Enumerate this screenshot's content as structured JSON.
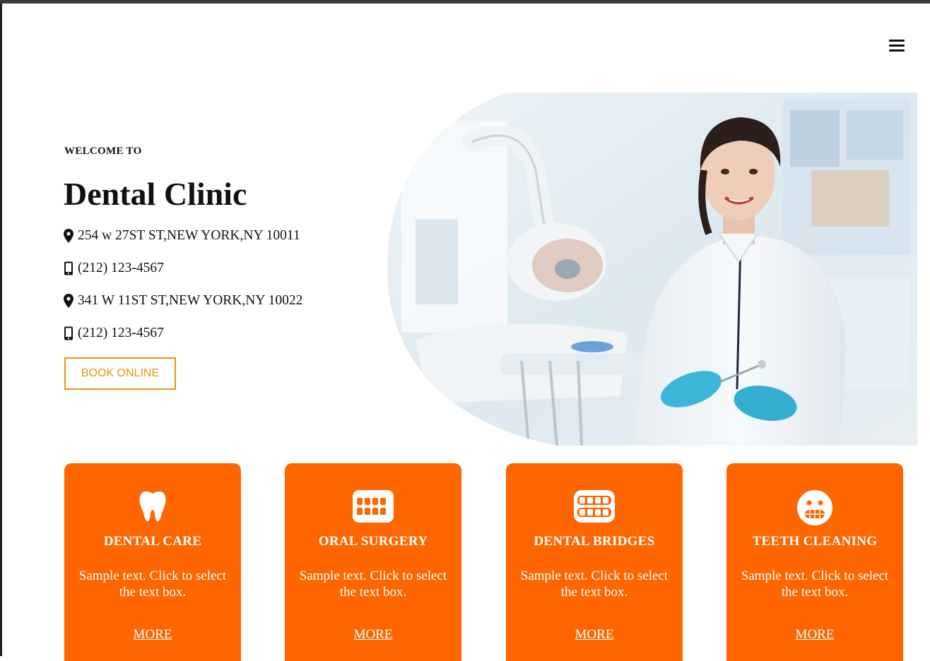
{
  "header": {
    "menu_icon": "hamburger-menu-icon"
  },
  "hero": {
    "welcome": "WELCOME TO",
    "title": "Dental Clinic",
    "contacts": [
      {
        "icon": "map-marker-icon",
        "text": "254 w 27ST ST,NEW YORK,NY 10011"
      },
      {
        "icon": "mobile-phone-icon",
        "text": "(212) 123-4567"
      },
      {
        "icon": "map-marker-icon",
        "text": "341 W 11ST ST,NEW YORK,NY 10022"
      },
      {
        "icon": "mobile-phone-icon",
        "text": "(212) 123-4567"
      }
    ],
    "book_label": "BOOK ONLINE",
    "image": "dentist-with-dental-chair-photo"
  },
  "services": [
    {
      "icon": "tooth-icon",
      "title": "DENTAL CARE",
      "text": "Sample text. Click to select the text box.",
      "more": "MORE"
    },
    {
      "icon": "teeth-grid-icon",
      "title": "ORAL SURGERY",
      "text": "Sample text. Click to select the text box.",
      "more": "MORE"
    },
    {
      "icon": "dentures-icon",
      "title": "DENTAL BRIDGES",
      "text": "Sample text. Click to select the text box.",
      "more": "MORE"
    },
    {
      "icon": "grimace-face-icon",
      "title": "TEETH CLEANING",
      "text": "Sample text. Click to select the text box.",
      "more": "MORE"
    }
  ],
  "colors": {
    "accent": "#ff6600",
    "button_outline": "#e59412"
  }
}
